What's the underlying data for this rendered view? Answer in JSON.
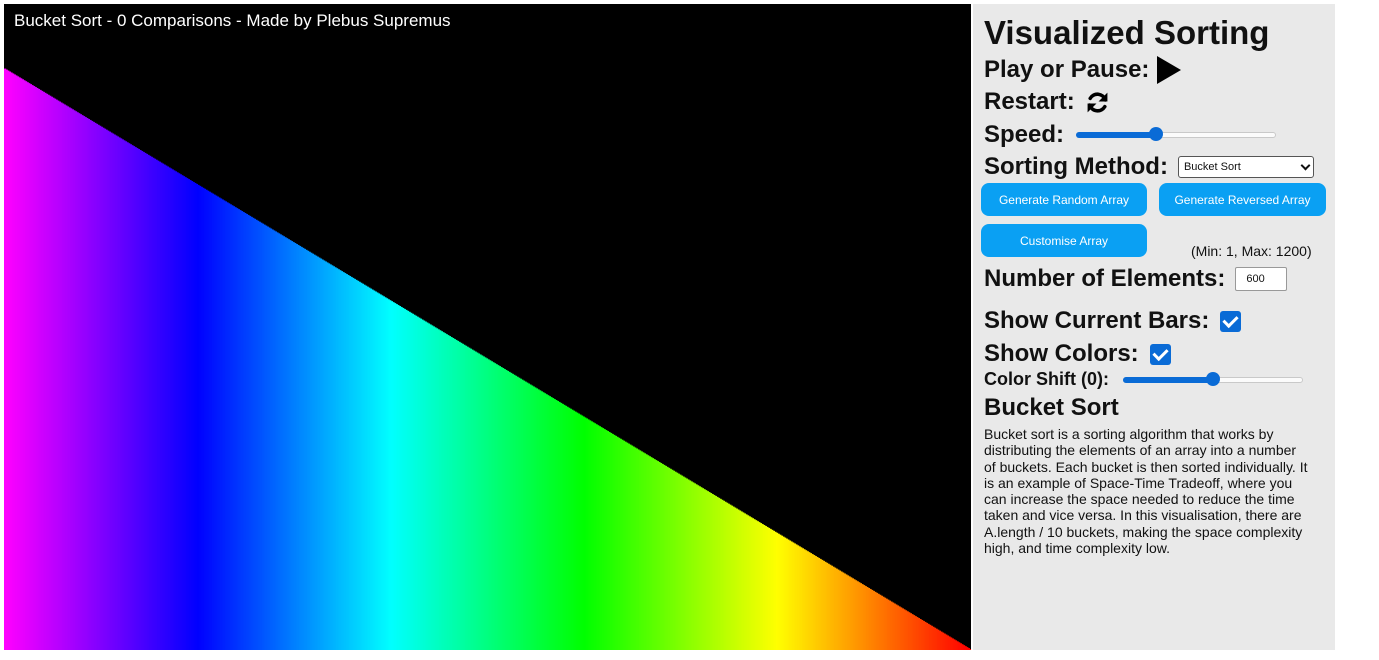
{
  "canvas": {
    "title": "Bucket Sort - 0 Comparisons - Made by Plebus Supremus",
    "element_count": 600,
    "bar_max_fraction": 0.9
  },
  "panel": {
    "title": "Visualized Sorting",
    "play_label": "Play or Pause:",
    "play_icon": "play-icon",
    "restart_label": "Restart:",
    "restart_icon": "refresh-icon",
    "speed_label": "Speed:",
    "speed_value_fraction": 0.4,
    "method_label": "Sorting Method:",
    "method_selected": "Bucket Sort",
    "buttons": {
      "random": "Generate Random Array",
      "reversed": "Generate Reversed Array",
      "custom": "Customise Array"
    },
    "range_note": "(Min: 1, Max: 1200)",
    "elements_label": "Number of Elements:",
    "elements_value": "600",
    "bars_label": "Show Current Bars:",
    "bars_checked": true,
    "colors_label": "Show Colors:",
    "colors_checked": true,
    "shift_label": "Color Shift (0):",
    "shift_value_fraction": 0.5,
    "description_title": "Bucket Sort",
    "description": "Bucket sort is a sorting algorithm that works by distributing the elements of an array into a number of buckets. Each bucket is then sorted individually. It is an example of Space-Time Tradeoff, where you can increase the space needed to reduce the time taken and vice versa. In this visualisation, there are A.length / 10 buckets, making the space complexity high, and time complexity low."
  },
  "colors": {
    "accent": "#0a6bd6",
    "button": "#0aa0f3",
    "panel_bg": "#e9e9e9",
    "canvas_bg": "#000000"
  }
}
